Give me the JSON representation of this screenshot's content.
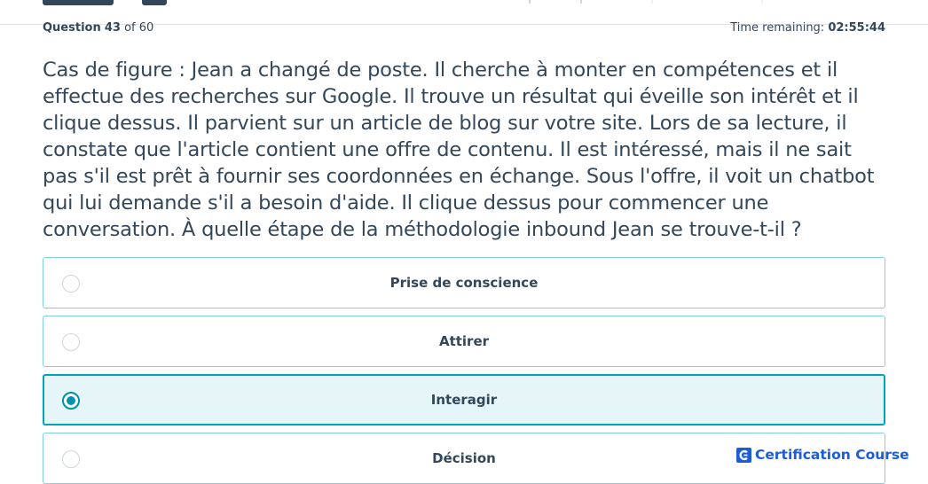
{
  "header": {
    "question_label": "Question",
    "question_current": "43",
    "question_total_text": "of 60",
    "time_label": "Time remaining:",
    "time_value": "02:55:44"
  },
  "question": {
    "text": "Cas de figure : Jean a changé de poste. Il cherche à monter en compétences et il effectue des recherches sur Google. Il trouve un résultat qui éveille son intérêt et il clique dessus. Il parvient sur un article de blog sur votre site. Lors de sa lecture, il constate que l'article contient une offre de contenu. Il est intéressé, mais il ne sait pas s'il est prêt à fournir ses coordonnées en échange. Sous l'offre, il voit un chatbot qui lui demande s'il a besoin d'aide. Il clique dessus pour commencer une conversation. À quelle étape de la méthodologie inbound Jean se trouve-t-il ?"
  },
  "answers": [
    {
      "label": "Prise de conscience",
      "selected": false
    },
    {
      "label": "Attirer",
      "selected": false
    },
    {
      "label": "Interagir",
      "selected": true
    },
    {
      "label": "Décision",
      "selected": false
    }
  ],
  "watermark": {
    "text": "Certification Course",
    "icon": "c-logo-icon"
  },
  "colors": {
    "text": "#33475b",
    "answer_border": "#7fd1de",
    "selected_border": "#00a4bd",
    "selected_bg": "#e5f5f8",
    "radio_selected": "#0091ae",
    "watermark": "#1a5dd6"
  }
}
